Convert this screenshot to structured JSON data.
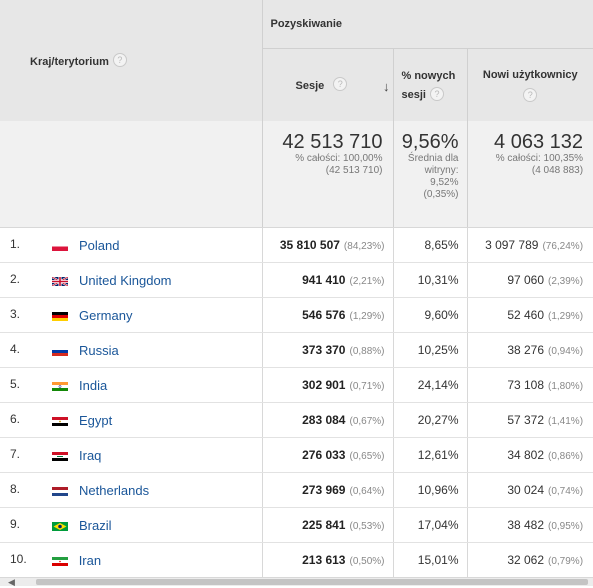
{
  "header": {
    "group_label": "Pozyskiwanie",
    "country_label": "Kraj/terytorium",
    "sessions_label": "Sesje",
    "new_sessions_label": "% nowych sesji",
    "new_users_label": "Nowi użytkownicy",
    "help_glyph": "?",
    "sort_glyph": "↓"
  },
  "totals": {
    "sessions": "42 513 710",
    "sessions_sub1": "% całości: 100,00%",
    "sessions_sub2": "(42 513 710)",
    "new_sessions": "9,56%",
    "new_sessions_sub1": "Średnia dla",
    "new_sessions_sub2": "witryny:",
    "new_sessions_sub3": "9,52%",
    "new_sessions_sub4": "(0,35%)",
    "new_users": "4 063 132",
    "new_users_sub1": "% całości: 100,35%",
    "new_users_sub2": "(4 048 883)"
  },
  "rows": [
    {
      "num": "1.",
      "country": "Poland",
      "flag": "poland-flag",
      "sessions": "35 810 507",
      "sessions_pct": "(84,23%)",
      "new_sessions": "8,65%",
      "new_users": "3 097 789",
      "new_users_pct": "(76,24%)"
    },
    {
      "num": "2.",
      "country": "United Kingdom",
      "flag": "uk-flag",
      "sessions": "941 410",
      "sessions_pct": "(2,21%)",
      "new_sessions": "10,31%",
      "new_users": "97 060",
      "new_users_pct": "(2,39%)"
    },
    {
      "num": "3.",
      "country": "Germany",
      "flag": "germany-flag",
      "sessions": "546 576",
      "sessions_pct": "(1,29%)",
      "new_sessions": "9,60%",
      "new_users": "52 460",
      "new_users_pct": "(1,29%)"
    },
    {
      "num": "4.",
      "country": "Russia",
      "flag": "russia-flag",
      "sessions": "373 370",
      "sessions_pct": "(0,88%)",
      "new_sessions": "10,25%",
      "new_users": "38 276",
      "new_users_pct": "(0,94%)"
    },
    {
      "num": "5.",
      "country": "India",
      "flag": "india-flag",
      "sessions": "302 901",
      "sessions_pct": "(0,71%)",
      "new_sessions": "24,14%",
      "new_users": "73 108",
      "new_users_pct": "(1,80%)"
    },
    {
      "num": "6.",
      "country": "Egypt",
      "flag": "egypt-flag",
      "sessions": "283 084",
      "sessions_pct": "(0,67%)",
      "new_sessions": "20,27%",
      "new_users": "57 372",
      "new_users_pct": "(1,41%)"
    },
    {
      "num": "7.",
      "country": "Iraq",
      "flag": "iraq-flag",
      "sessions": "276 033",
      "sessions_pct": "(0,65%)",
      "new_sessions": "12,61%",
      "new_users": "34 802",
      "new_users_pct": "(0,86%)"
    },
    {
      "num": "8.",
      "country": "Netherlands",
      "flag": "netherlands-flag",
      "sessions": "273 969",
      "sessions_pct": "(0,64%)",
      "new_sessions": "10,96%",
      "new_users": "30 024",
      "new_users_pct": "(0,74%)"
    },
    {
      "num": "9.",
      "country": "Brazil",
      "flag": "brazil-flag",
      "sessions": "225 841",
      "sessions_pct": "(0,53%)",
      "new_sessions": "17,04%",
      "new_users": "38 482",
      "new_users_pct": "(0,95%)"
    },
    {
      "num": "10.",
      "country": "Iran",
      "flag": "iran-flag",
      "sessions": "213 613",
      "sessions_pct": "(0,50%)",
      "new_sessions": "15,01%",
      "new_users": "32 062",
      "new_users_pct": "(0,79%)"
    }
  ]
}
